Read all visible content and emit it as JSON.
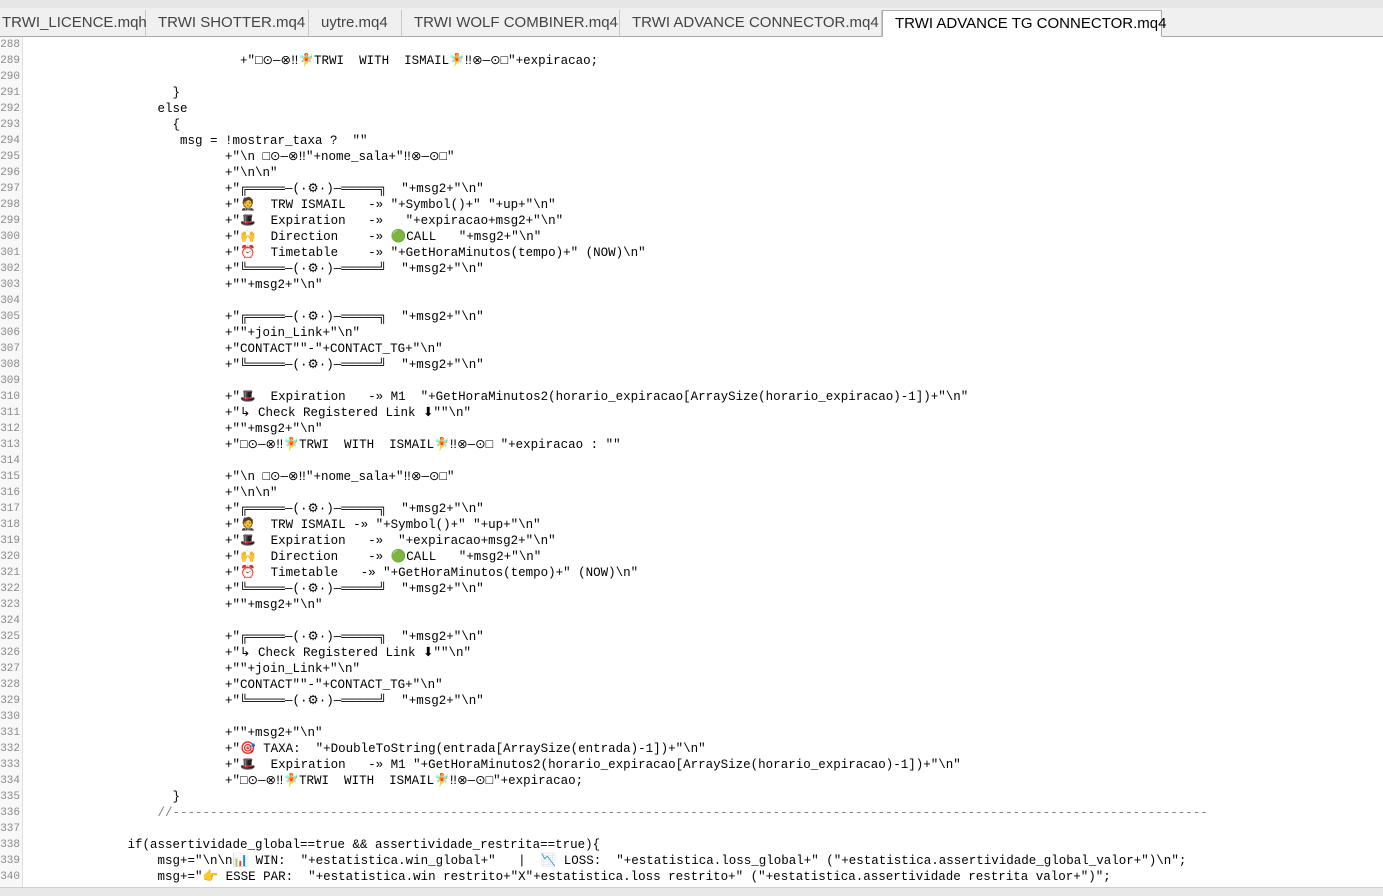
{
  "tabs": [
    {
      "label": "TRWI_LICENCE.mqh",
      "active": false
    },
    {
      "label": "TRWI SHOTTER.mq4",
      "active": false
    },
    {
      "label": "uytre.mq4",
      "active": false
    },
    {
      "label": "TRWI WOLF COMBINER.mq4",
      "active": false
    },
    {
      "label": "TRWI ADVANCE CONNECTOR.mq4",
      "active": false
    },
    {
      "label": "TRWI ADVANCE TG CONNECTOR.mq4",
      "active": true
    }
  ],
  "lines": [
    {
      "num": "288",
      "text": ""
    },
    {
      "num": "289",
      "text": "                                +\"□⊙—⊗‼🧚TRWI  WITH  ISMAIL🧚‼⊗—⊙□\"+expiracao;"
    },
    {
      "num": "290",
      "text": ""
    },
    {
      "num": "291",
      "text": "                       }"
    },
    {
      "num": "292",
      "text": "                     else"
    },
    {
      "num": "293",
      "text": "                       {"
    },
    {
      "num": "294",
      "text": "                        msg = !mostrar_taxa ?  \"\""
    },
    {
      "num": "295",
      "text": "                              +\"\\n □⊙—⊗‼\"+nome_sala+\"‼⊗—⊙□\""
    },
    {
      "num": "296",
      "text": "                              +\"\\n\\n\""
    },
    {
      "num": "297",
      "text": "                              +\"╔═════—(·⚙·)—═════╗  \"+msg2+\"\\n\""
    },
    {
      "num": "298",
      "text": "                              +\"🤵  TRW ISMAIL   -» \"+Symbol()+\" \"+up+\"\\n\""
    },
    {
      "num": "299",
      "text": "                              +\"🎩  Expiration   -»   \"+expiracao+msg2+\"\\n\""
    },
    {
      "num": "300",
      "text": "                              +\"🙌  Direction    -» 🟢CALL   \"+msg2+\"\\n\""
    },
    {
      "num": "301",
      "text": "                              +\"⏰  Timetable    -» \"+GetHoraMinutos(tempo)+\" (NOW)\\n\""
    },
    {
      "num": "302",
      "text": "                              +\"╚═════—(·⚙·)—═════╝  \"+msg2+\"\\n\""
    },
    {
      "num": "303",
      "text": "                              +\"\"+msg2+\"\\n\""
    },
    {
      "num": "304",
      "text": ""
    },
    {
      "num": "305",
      "text": "                              +\"╔═════—(·⚙·)—═════╗  \"+msg2+\"\\n\""
    },
    {
      "num": "306",
      "text": "                              +\"\"+join_Link+\"\\n\""
    },
    {
      "num": "307",
      "text": "                              +\"CONTACT\"\"-\"+CONTACT_TG+\"\\n\""
    },
    {
      "num": "308",
      "text": "                              +\"╚═════—(·⚙·)—═════╝  \"+msg2+\"\\n\""
    },
    {
      "num": "309",
      "text": ""
    },
    {
      "num": "310",
      "text": "                              +\"🎩  Expiration   -» M1  \"+GetHoraMinutos2(horario_expiracao[ArraySize(horario_expiracao)-1])+\"\\n\""
    },
    {
      "num": "311",
      "text": "                              +\"↳ Check Registered Link ⬇\"\"\\n\""
    },
    {
      "num": "312",
      "text": "                              +\"\"+msg2+\"\\n\""
    },
    {
      "num": "313",
      "text": "                              +\"□⊙—⊗‼🧚TRWI  WITH  ISMAIL🧚‼⊗—⊙□ \"+expiracao : \"\""
    },
    {
      "num": "314",
      "text": ""
    },
    {
      "num": "315",
      "text": "                              +\"\\n □⊙—⊗‼\"+nome_sala+\"‼⊗—⊙□\""
    },
    {
      "num": "316",
      "text": "                              +\"\\n\\n\""
    },
    {
      "num": "317",
      "text": "                              +\"╔═════—(·⚙·)—═════╗  \"+msg2+\"\\n\""
    },
    {
      "num": "318",
      "text": "                              +\"🤵  TRW ISMAIL -» \"+Symbol()+\" \"+up+\"\\n\""
    },
    {
      "num": "319",
      "text": "                              +\"🎩  Expiration   -»  \"+expiracao+msg2+\"\\n\""
    },
    {
      "num": "320",
      "text": "                              +\"🙌  Direction    -» 🟢CALL   \"+msg2+\"\\n\""
    },
    {
      "num": "321",
      "text": "                              +\"⏰  Timetable   -» \"+GetHoraMinutos(tempo)+\" (NOW)\\n\""
    },
    {
      "num": "322",
      "text": "                              +\"╚═════—(·⚙·)—═════╝  \"+msg2+\"\\n\""
    },
    {
      "num": "323",
      "text": "                              +\"\"+msg2+\"\\n\""
    },
    {
      "num": "324",
      "text": ""
    },
    {
      "num": "325",
      "text": "                              +\"╔═════—(·⚙·)—═════╗  \"+msg2+\"\\n\""
    },
    {
      "num": "326",
      "text": "                              +\"↳ Check Registered Link ⬇\"\"\\n\""
    },
    {
      "num": "327",
      "text": "                              +\"\"+join_Link+\"\\n\""
    },
    {
      "num": "328",
      "text": "                              +\"CONTACT\"\"-\"+CONTACT_TG+\"\\n\""
    },
    {
      "num": "329",
      "text": "                              +\"╚═════—(·⚙·)—═════╝  \"+msg2+\"\\n\""
    },
    {
      "num": "330",
      "text": ""
    },
    {
      "num": "331",
      "text": "                              +\"\"+msg2+\"\\n\""
    },
    {
      "num": "332",
      "text": "                              +\"🎯 TAXA:  \"+DoubleToString(entrada[ArraySize(entrada)-1])+\"\\n\""
    },
    {
      "num": "333",
      "text": "                              +\"🎩  Expiration   -» M1 \"+GetHoraMinutos2(horario_expiracao[ArraySize(horario_expiracao)-1])+\"\\n\""
    },
    {
      "num": "334",
      "text": "                              +\"□⊙—⊗‼🧚TRWI  WITH  ISMAIL🧚‼⊗—⊙□\"+expiracao;"
    },
    {
      "num": "335",
      "text": "                       }"
    },
    {
      "num": "336",
      "text": "                     //------------------------------------------------------------------------------------------------------------------------------------------"
    },
    {
      "num": "337",
      "text": ""
    },
    {
      "num": "338",
      "text": "                 if(assertividade_global==true && assertividade_restrita==true){"
    },
    {
      "num": "339",
      "text": "                     msg+=\"\\n\\n📊 WIN:  \"+estatistica.win_global+\"   |  📉 LOSS:  \"+estatistica.loss_global+\" (\"+estatistica.assertividade_global_valor+\")\\n\";"
    },
    {
      "num": "340",
      "text": "                     msg+=\"👉 ESSE PAR:  \"+estatistica.win restrito+\"X\"+estatistica.loss restrito+\" (\"+estatistica.assertividade restrita valor+\")\";"
    }
  ]
}
